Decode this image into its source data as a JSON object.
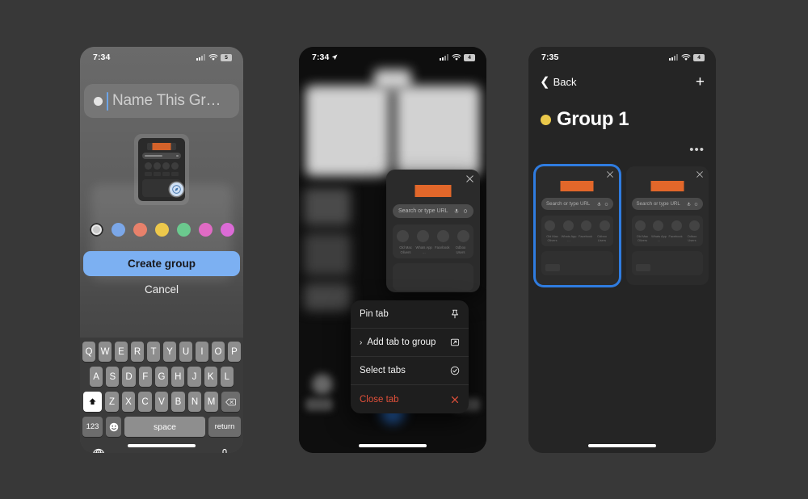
{
  "background_color": "#383838",
  "accent_blue": "#2f7ce0",
  "panel1": {
    "status": {
      "time": "7:34",
      "battery": "5",
      "location_arrow": false
    },
    "name_field": {
      "placeholder": "Name This Gr…",
      "value": ""
    },
    "swatches": [
      {
        "name": "default",
        "color": "#c9c9c9",
        "selected": true
      },
      {
        "name": "blue",
        "color": "#7ba7e8",
        "selected": false
      },
      {
        "name": "orange",
        "color": "#e8816b",
        "selected": false
      },
      {
        "name": "yellow",
        "color": "#edc84b",
        "selected": false
      },
      {
        "name": "green",
        "color": "#6bc98e",
        "selected": false
      },
      {
        "name": "pink",
        "color": "#e06bc4",
        "selected": false
      },
      {
        "name": "magenta",
        "color": "#db6bd6",
        "selected": false
      }
    ],
    "create_label": "Create group",
    "cancel_label": "Cancel",
    "keyboard": {
      "row1": [
        "Q",
        "W",
        "E",
        "R",
        "T",
        "Y",
        "U",
        "I",
        "O",
        "P"
      ],
      "row2": [
        "A",
        "S",
        "D",
        "F",
        "G",
        "H",
        "J",
        "K",
        "L"
      ],
      "row3": [
        "Z",
        "X",
        "C",
        "V",
        "B",
        "N",
        "M"
      ],
      "shift": "⬆",
      "backspace": "⌫",
      "numbers": "123",
      "emoji": "☺",
      "space": "space",
      "return": "return"
    }
  },
  "panel2": {
    "status": {
      "time": "7:34",
      "battery": "4",
      "location_arrow": true
    },
    "tab_card": {
      "url_placeholder": "Search or type URL",
      "shortcuts": [
        "Old Mac Olivers",
        "Whats App …",
        "Facebook",
        "Odboo Users"
      ]
    },
    "context_menu": [
      {
        "label": "Pin tab",
        "icon": "pin-icon",
        "danger": false,
        "submenu": false
      },
      {
        "label": "Add tab to group",
        "icon": "rectangle-arrow-icon",
        "danger": false,
        "submenu": true
      },
      {
        "label": "Select tabs",
        "icon": "checkmark-circle-icon",
        "danger": false,
        "submenu": false
      },
      {
        "label": "Close tab",
        "icon": "close-x-icon",
        "danger": true,
        "submenu": false
      }
    ]
  },
  "panel3": {
    "status": {
      "time": "7:35",
      "battery": "4",
      "location_arrow": false
    },
    "nav": {
      "back_label": "Back",
      "add_label": "+"
    },
    "group": {
      "title": "Group 1",
      "dot_color": "#eac84a",
      "more_label": "•••"
    },
    "tabs": [
      {
        "url_placeholder": "Search or type URL",
        "selected": true,
        "shortcuts": [
          "Old Mac Olivers",
          "Whats App …",
          "Facebook",
          "Odboo Users"
        ]
      },
      {
        "url_placeholder": "Search or type URL",
        "selected": false,
        "shortcuts": [
          "Old Mac Olivers",
          "Whats App …",
          "Facebook",
          "Odboo Users"
        ]
      }
    ]
  }
}
